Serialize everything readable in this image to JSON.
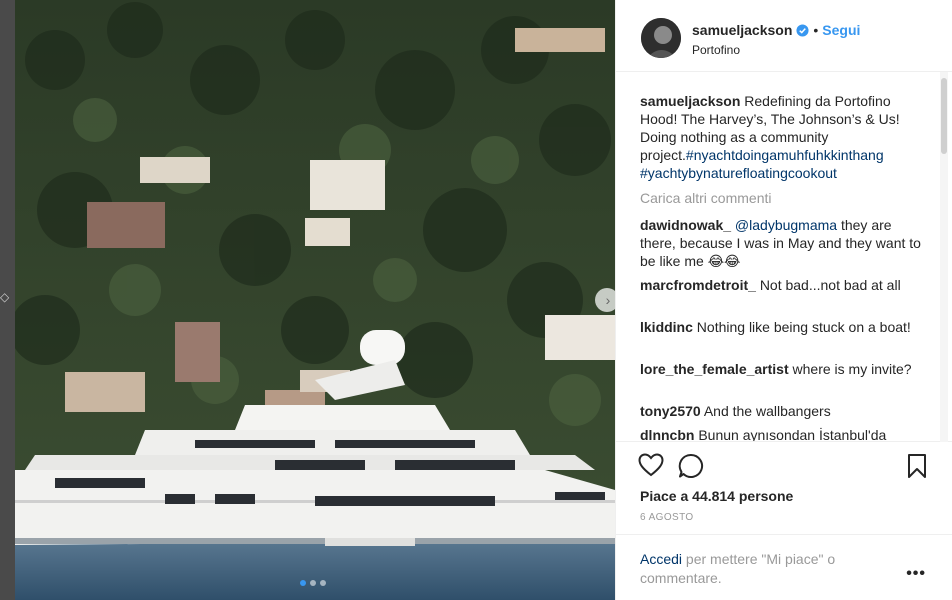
{
  "post": {
    "username": "samueljackson",
    "follow_label": "Segui",
    "separator": "•",
    "location": "Portofino",
    "verified_icon": "verified-badge-icon"
  },
  "caption": {
    "username": "samueljackson",
    "text": "Redefining da Portofino Hood! The Harvey’s, The Johnson’s & Us! Doing nothing as a community project.",
    "hashtag1": "#nyachtdoingamuhfuhkkinthang",
    "hashtag2": "#yachtybynaturefloatingcookout"
  },
  "load_more": "Carica altri commenti",
  "comments": [
    {
      "user": "dawidnowak_",
      "mention": "@ladybugmama",
      "text": "they are there, because I was in May and they want to be like me 😂😂"
    },
    {
      "user": "marcfromdetroit_",
      "text": "Not bad...not bad at all"
    },
    {
      "user": "lkiddinc",
      "text": "Nothing like being stuck on a boat!"
    },
    {
      "user": "lore_the_female_artist",
      "text": "where is my invite?"
    },
    {
      "user": "tony2570",
      "text": "And the wallbangers"
    },
    {
      "user": "dlnncbn",
      "text": "Bunun aynısondan İstanbul'da"
    }
  ],
  "stats": {
    "likes": "Piace a 44.814 persone",
    "date": "6 AGOSTO"
  },
  "footer": {
    "login_link": "Accedi",
    "login_text": "per mettere \"Mi piace\" o commentare.",
    "more_icon": "•••"
  },
  "carousel": {
    "total": 3,
    "active": 1
  },
  "colors": {
    "accent": "#3897f0",
    "link": "#003569",
    "muted": "#999999",
    "text": "#262626"
  }
}
